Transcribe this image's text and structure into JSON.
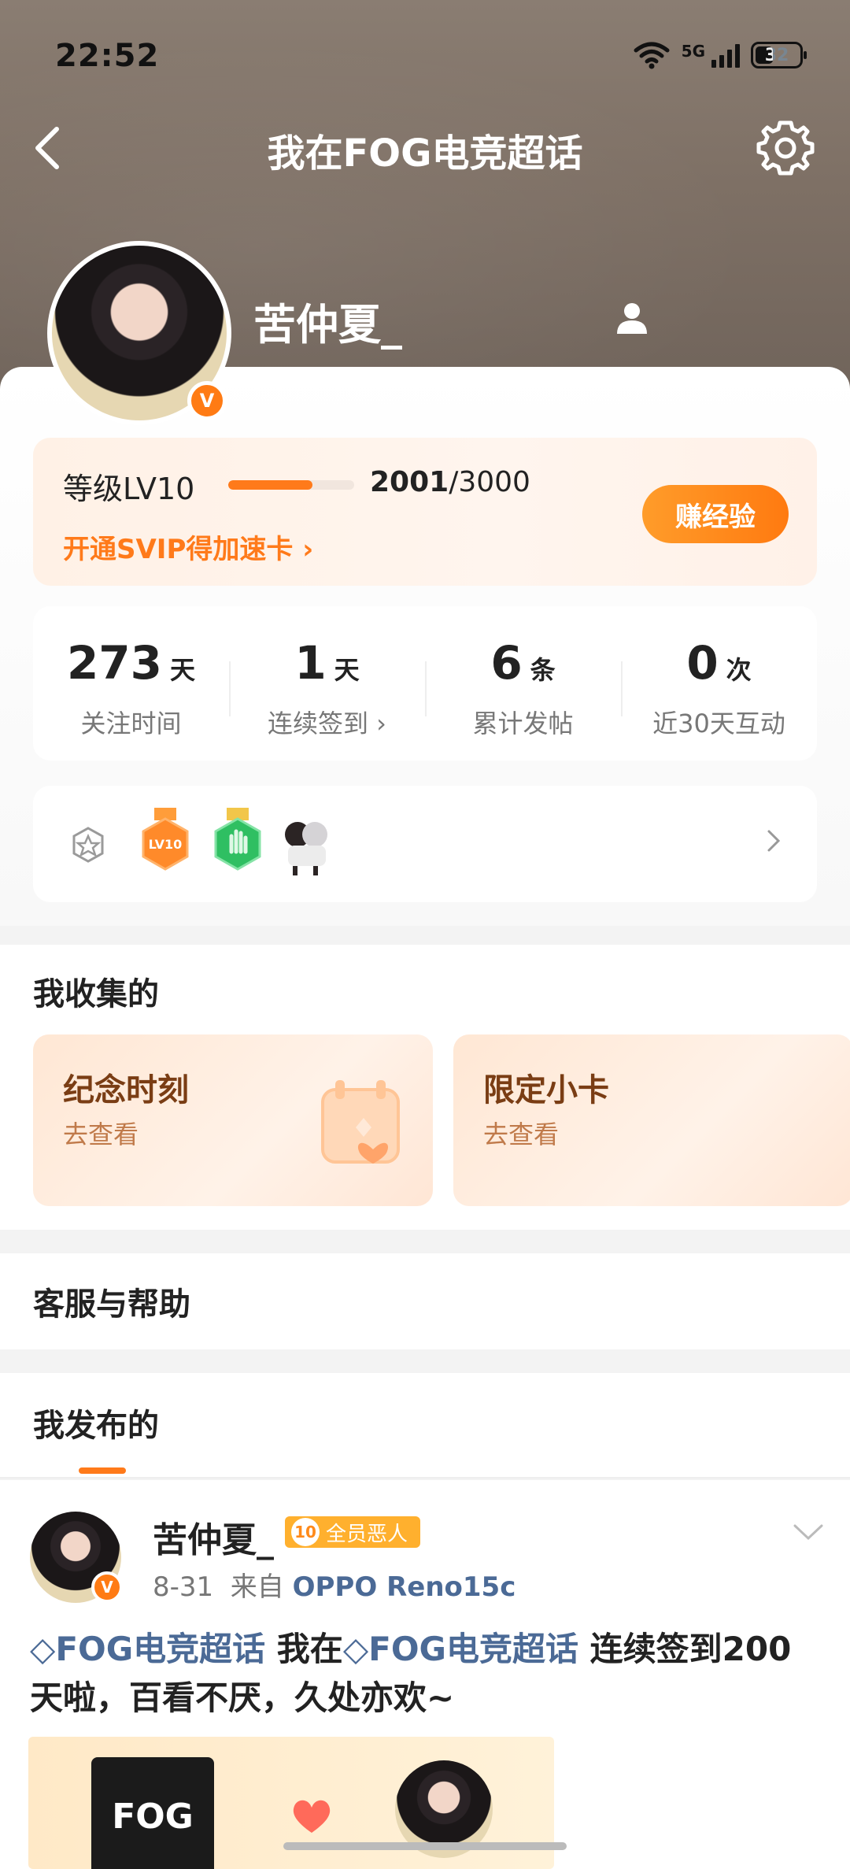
{
  "status": {
    "time": "22:52",
    "network": "5G",
    "battery": "32"
  },
  "nav": {
    "title": "我在FOG电竞超话"
  },
  "profile": {
    "name": "苦仲夏_"
  },
  "level": {
    "label": "等级LV10",
    "progress": 0.667,
    "score_current": "2001",
    "score_total": "/3000",
    "svip_link": "开通SVIP得加速卡 ›",
    "earn_button": "赚经验"
  },
  "stats": [
    {
      "num": "273",
      "unit": "天",
      "label": "关注时间"
    },
    {
      "num": "1",
      "unit": "天",
      "label": "连续签到 ›"
    },
    {
      "num": "6",
      "unit": "条",
      "label": "累计发帖"
    },
    {
      "num": "0",
      "unit": "次",
      "label": "近30天互动"
    }
  ],
  "collections": {
    "title": "我收集的",
    "cards": [
      {
        "title": "纪念时刻",
        "sub": "去查看"
      },
      {
        "title": "限定小卡",
        "sub": "去查看"
      }
    ]
  },
  "help": {
    "title": "客服与帮助"
  },
  "posts_tab": {
    "title": "我发布的"
  },
  "post": {
    "author": "苦仲夏_",
    "badge_level": "10",
    "badge_text": "全员恶人",
    "date": "8-31",
    "from": "来自",
    "device": "OPPO Reno15c",
    "topic1": "FOG电竞超话",
    "text1": " 我在",
    "topic2": "FOG电竞超话",
    "text2": " 连续签到200天啦，百看不厌，久处亦欢~",
    "image_logo": "FOG"
  },
  "colors": {
    "accent": "#ff7a1a",
    "topic": "#4b6a96",
    "hero": "#7e7065"
  }
}
